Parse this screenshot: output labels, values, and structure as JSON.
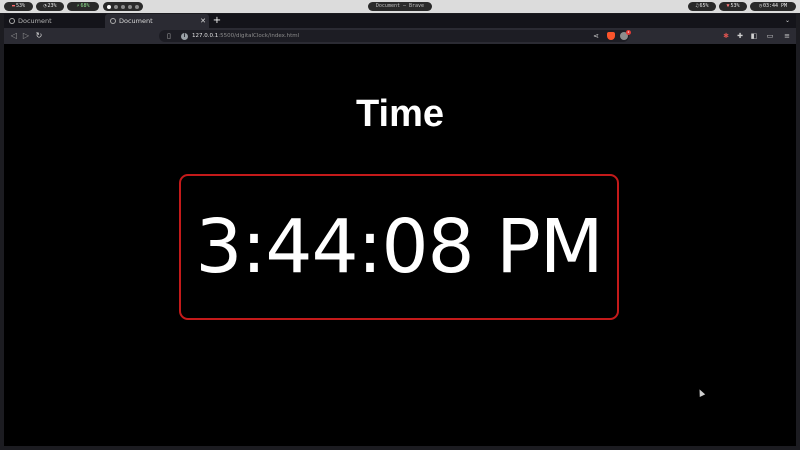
{
  "system_bar": {
    "cpu": "53%",
    "memory": "23%",
    "battery": "68%",
    "window_title": "Document — Brave",
    "volume": "65%",
    "wifi": "53%",
    "clock": "03:44 PM"
  },
  "tabs": [
    {
      "label": "Document",
      "active": false
    },
    {
      "label": "Document",
      "active": true
    }
  ],
  "toolbar": {
    "url_host": "127.0.0.1",
    "url_rest": ":5500/digitalClock/index.html",
    "shield_badge": "2"
  },
  "page": {
    "heading": "Time",
    "clock": "3:44:08 PM"
  },
  "colors": {
    "page_background": "#000000",
    "clock_border": "#c41a1a",
    "text": "#ffffff"
  }
}
